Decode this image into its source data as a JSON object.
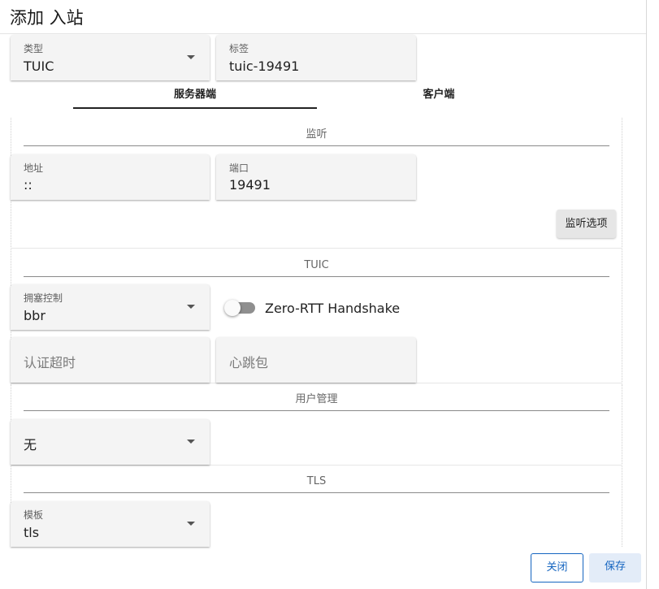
{
  "dialog": {
    "title": "添加 入站"
  },
  "basic": {
    "type": {
      "label": "类型",
      "value": "TUIC"
    },
    "tag": {
      "label": "标签",
      "value": "tuic-19491"
    }
  },
  "tabs": [
    {
      "label": "服务器端",
      "active": true
    },
    {
      "label": "客户端",
      "active": false
    }
  ],
  "listen": {
    "section_title": "监听",
    "address": {
      "label": "地址",
      "value": "::"
    },
    "port": {
      "label": "端口",
      "value": "19491"
    },
    "options_button": "监听选项"
  },
  "tuic": {
    "section_title": "TUIC",
    "congestion_control": {
      "label": "拥塞控制",
      "value": "bbr"
    },
    "zero_rtt": {
      "label": "Zero-RTT Handshake",
      "enabled": false
    },
    "auth_timeout": {
      "placeholder": "认证超时"
    },
    "heartbeat": {
      "placeholder": "心跳包"
    }
  },
  "users": {
    "section_title": "用户管理",
    "select": {
      "value": "无"
    }
  },
  "tls": {
    "section_title": "TLS",
    "template": {
      "label": "模板",
      "value": "tls"
    }
  },
  "footer": {
    "close_label": "关闭",
    "save_label": "保存"
  },
  "colors": {
    "primary": "#1565c0",
    "switch_track_off": "#8f8f8f",
    "field_bg": "#f4f4f4"
  },
  "icons": {
    "dropdown": "chevron-down-icon"
  }
}
